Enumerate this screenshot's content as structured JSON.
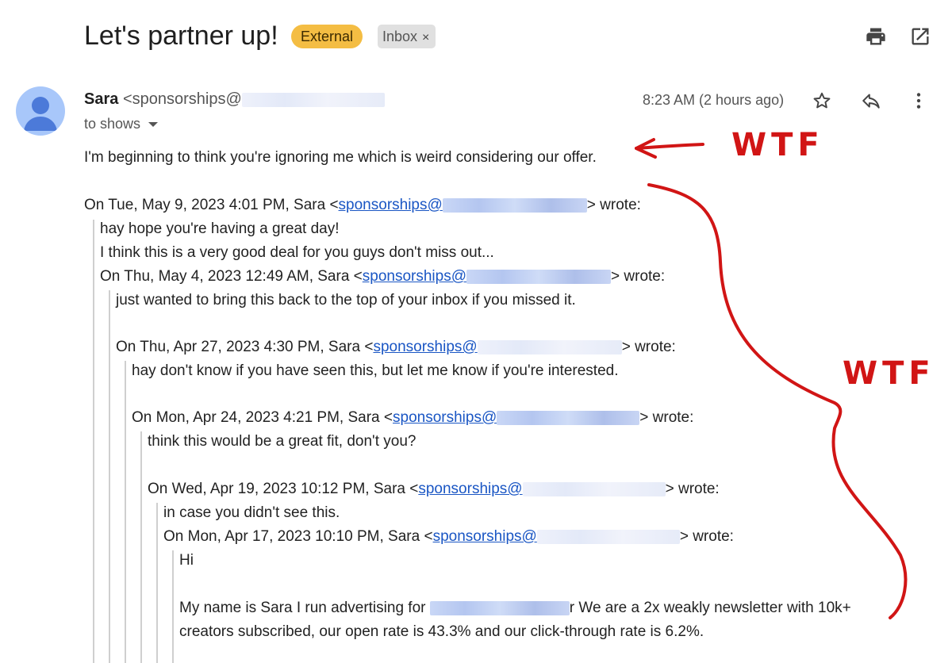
{
  "subject": "Let's partner up!",
  "labels": {
    "external": "External",
    "inbox": "Inbox",
    "remove": "×"
  },
  "sender": {
    "name": "Sara",
    "email_prefix": "<sponsorships@"
  },
  "recipients": "to shows",
  "time": "8:23 AM (2 hours ago)",
  "body": "I'm beginning to think you're ignoring me which is weird considering our offer.",
  "quotes": [
    {
      "header_prefix": "On Tue, May 9, 2023 4:01 PM, Sara <",
      "link": "sponsorships@",
      "suffix": "> wrote:",
      "lines": [
        "hay hope you're having a great day!",
        "I think this is a very good deal for you guys don't miss out..."
      ]
    },
    {
      "header_prefix": "On Thu, May 4, 2023 12:49 AM, Sara <",
      "link": "sponsorships@",
      "suffix": "> wrote:",
      "lines": [
        "just wanted to bring this back to the top of your inbox if you missed it."
      ]
    },
    {
      "header_prefix": "On Thu, Apr 27, 2023 4:30 PM, Sara <",
      "link": "sponsorships@",
      "suffix": "> wrote:",
      "lines": [
        "hay don't know if you have seen this, but let me know if you're interested."
      ]
    },
    {
      "header_prefix": "On Mon, Apr 24, 2023 4:21 PM, Sara <",
      "link": "sponsorships@",
      "suffix": "> wrote:",
      "lines": [
        "think this would be a great fit, don't you?"
      ]
    },
    {
      "header_prefix": "On Wed, Apr 19, 2023 10:12 PM, Sara <",
      "link": "sponsorships@",
      "suffix": "> wrote:",
      "lines": [
        "in case you didn't see this."
      ]
    },
    {
      "header_prefix": "On Mon, Apr 17, 2023 10:10 PM, Sara <",
      "link": "sponsorships@",
      "suffix": "> wrote:",
      "lines": [
        "Hi",
        "My name is Sara I run advertising for",
        "r We are a 2x weakly newsletter with 10k+",
        "creators subscribed, our open rate is 43.3% and our click-through rate is 6.2%."
      ]
    }
  ],
  "annotations": [
    "WTF",
    "WTF"
  ],
  "icons": [
    "print-icon",
    "open-in-new-window-icon",
    "star-icon",
    "reply-icon",
    "more-vert-icon",
    "avatar-person-icon"
  ],
  "colors": {
    "external_chip": "#f4bd43",
    "link": "#1a56c4",
    "annotation": "#d11515"
  }
}
